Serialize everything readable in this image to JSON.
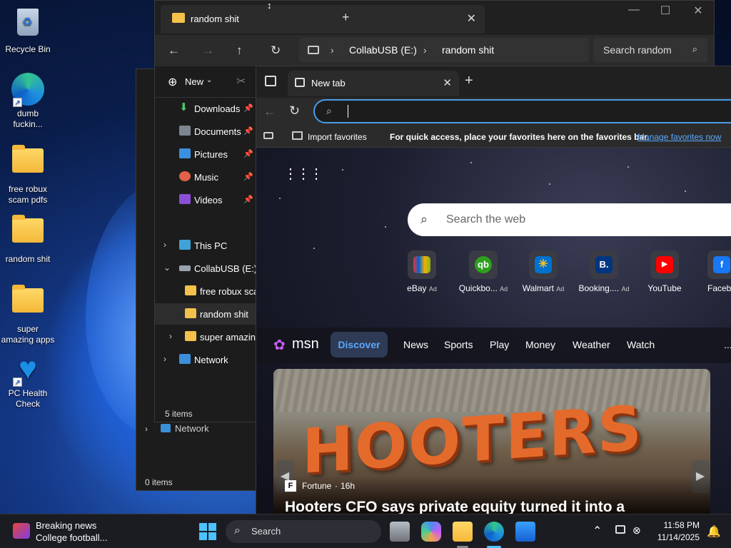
{
  "desktop": {
    "icons": [
      {
        "label": "Recycle Bin"
      },
      {
        "label": "dumb fuckin..."
      },
      {
        "label": "free robux scam pdfs"
      },
      {
        "label": "random shit"
      },
      {
        "label": "super amazing apps"
      },
      {
        "label": "PC Health Check"
      }
    ]
  },
  "explorer_back": {
    "nav_network": "Network",
    "status": "0 items"
  },
  "explorer": {
    "tab_title": "random shit",
    "new_tab": "+",
    "window_controls": {
      "minimize": "—",
      "maximize": "☐",
      "close": "✕"
    },
    "breadcrumb": {
      "drive": "CollabUSB (E:)",
      "folder": "random shit"
    },
    "search_placeholder": "Search random",
    "new_label": "New",
    "nav": {
      "downloads": "Downloads",
      "documents": "Documents",
      "pictures": "Pictures",
      "music": "Music",
      "videos": "Videos",
      "this_pc": "This PC",
      "drive": "CollabUSB (E:)",
      "folder1": "free robux scam",
      "folder2": "random shit",
      "folder3": "super amazing",
      "network": "Network"
    },
    "status": "5 items"
  },
  "edge": {
    "tab_title": "New tab",
    "import_favorites": "Import favorites",
    "favbar_text": "For quick access, place your favorites here on the favorites bar.",
    "manage_link": "Manage favorites now",
    "search_placeholder": "Search the web",
    "tiles": [
      {
        "label": "eBay",
        "ad": "Ad"
      },
      {
        "label": "Quickbo...",
        "ad": "Ad"
      },
      {
        "label": "Walmart",
        "ad": "Ad"
      },
      {
        "label": "Booking....",
        "ad": "Ad"
      },
      {
        "label": "YouTube",
        "ad": ""
      },
      {
        "label": "Facebo",
        "ad": ""
      }
    ],
    "msn": {
      "brand": "msn",
      "tabs": [
        "Discover",
        "News",
        "Sports",
        "Play",
        "Money",
        "Weather",
        "Watch"
      ],
      "more": "..."
    },
    "hero": {
      "sign": "HOOTERS",
      "source": "Fortune",
      "age": "16h",
      "headline": "Hooters CFO says private equity turned it into a"
    }
  },
  "taskbar": {
    "news_title": "Breaking news",
    "news_sub": "College football...",
    "search_label": "Search",
    "time": "11:58 PM",
    "date": "11/14/2025"
  },
  "colors": {
    "accent": "#4c9be8",
    "link": "#5aa8ff",
    "folder": "#f4c14b"
  }
}
